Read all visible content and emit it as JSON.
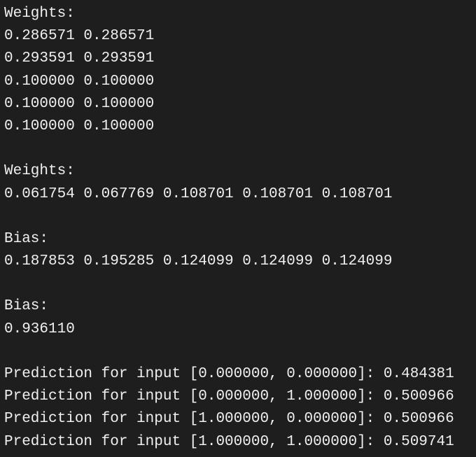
{
  "terminal": {
    "lines": [
      "Weights:",
      "0.286571 0.286571",
      "0.293591 0.293591",
      "0.100000 0.100000",
      "0.100000 0.100000",
      "0.100000 0.100000",
      "",
      "Weights:",
      "0.061754 0.067769 0.108701 0.108701 0.108701",
      "",
      "Bias:",
      "0.187853 0.195285 0.124099 0.124099 0.124099",
      "",
      "Bias:",
      "0.936110",
      "",
      "Prediction for input [0.000000, 0.000000]: 0.484381",
      "Prediction for input [0.000000, 1.000000]: 0.500966",
      "Prediction for input [1.000000, 0.000000]: 0.500966",
      "Prediction for input [1.000000, 1.000000]: 0.509741"
    ]
  }
}
